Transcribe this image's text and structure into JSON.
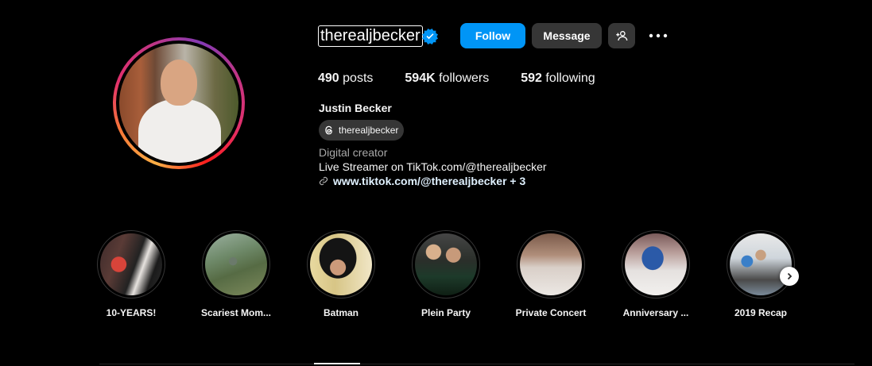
{
  "profile": {
    "username": "therealjbecker",
    "verified": true,
    "full_name": "Justin Becker",
    "threads_handle": "therealjbecker",
    "category": "Digital creator",
    "bio": "Live Streamer on TikTok.com/@therealjbecker",
    "link": "www.tiktok.com/@therealjbecker + 3"
  },
  "actions": {
    "follow_label": "Follow",
    "message_label": "Message",
    "add_user_icon": "person-add-icon",
    "more_icon": "more-horizontal-icon"
  },
  "stats": {
    "posts_count": "490",
    "posts_label": "posts",
    "followers_count": "594K",
    "followers_label": "followers",
    "following_count": "592",
    "following_label": "following"
  },
  "highlights": [
    {
      "label": "10-YEARS!"
    },
    {
      "label": "Scariest Mom..."
    },
    {
      "label": "Batman"
    },
    {
      "label": "Plein Party"
    },
    {
      "label": "Private Concert"
    },
    {
      "label": "Anniversary ..."
    },
    {
      "label": "2019 Recap"
    }
  ],
  "colors": {
    "accent": "#0095f6",
    "button_secondary": "#363636",
    "background": "#000000",
    "verified_badge": "#0095f6"
  }
}
